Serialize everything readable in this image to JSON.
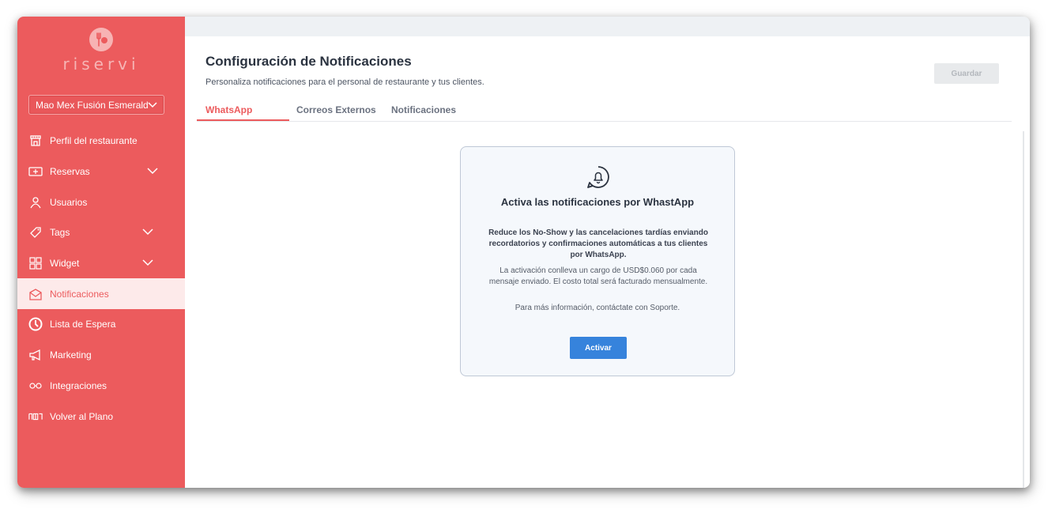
{
  "sidebar": {
    "brand": "riservi",
    "restaurant_selected": "Mao Mex Fusión Esmerald",
    "items": [
      {
        "label": "Perfil del restaurante",
        "icon": "storefront-icon"
      },
      {
        "label": "Reservas",
        "icon": "reservations-icon",
        "expandable": true
      },
      {
        "label": "Usuarios",
        "icon": "user-icon"
      },
      {
        "label": "Tags",
        "icon": "tag-icon",
        "expandable": true
      },
      {
        "label": "Widget",
        "icon": "widget-grid-icon",
        "expandable": true
      },
      {
        "label": "Notificaciones",
        "icon": "mail-icon",
        "active": true
      },
      {
        "label": "Lista de Espera",
        "icon": "clock-icon"
      },
      {
        "label": "Marketing",
        "icon": "megaphone-icon"
      },
      {
        "label": "Integraciones",
        "icon": "integrations-icon"
      },
      {
        "label": "Volver al Plano",
        "icon": "floor-plan-icon"
      }
    ]
  },
  "header": {
    "title": "Configuración de Notificaciones",
    "subtitle": "Personaliza notificaciones para el personal de restaurante y tus clientes.",
    "save_label": "Guardar"
  },
  "tabs": [
    {
      "label": "WhatsApp",
      "active": true
    },
    {
      "label": "Correos Externos"
    },
    {
      "label": "Notificaciones"
    }
  ],
  "card": {
    "icon": "whatsapp-bell-icon",
    "title": "Activa las notificaciones por WhastApp",
    "description": "Reduce los No-Show y las cancelaciones tardías enviando recordatorios y confirmaciones automáticas a tus clientes por WhatsApp.",
    "cost_note": "La activación conlleva un cargo de USD$0.060 por cada mensaje enviado. El costo total será facturado mensualmente.",
    "support_note": "Para más información, contáctate con Soporte.",
    "button_label": "Activar"
  },
  "colors": {
    "brand": "#ec5b5d",
    "active_bg": "#fdeaea",
    "button_blue": "#3683dc"
  }
}
